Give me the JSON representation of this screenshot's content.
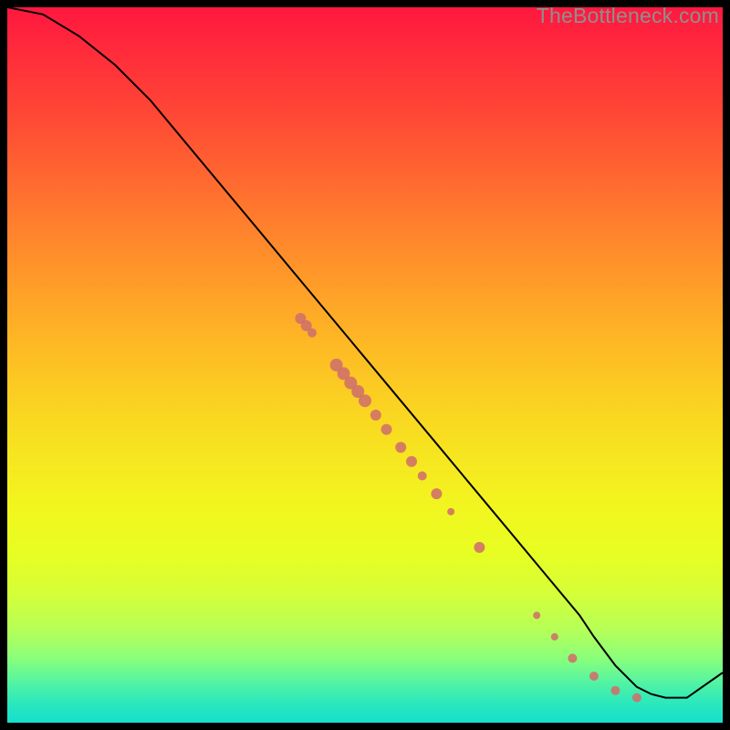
{
  "watermark": {
    "text": "TheBottleneck.com"
  },
  "chart_data": {
    "type": "line",
    "title": "",
    "xlabel": "",
    "ylabel": "",
    "xlim": [
      0,
      100
    ],
    "ylim": [
      0,
      100
    ],
    "grid": false,
    "legend": false,
    "series": [
      {
        "name": "curve",
        "x": [
          0,
          5,
          10,
          15,
          20,
          25,
          30,
          35,
          40,
          45,
          50,
          55,
          60,
          65,
          70,
          75,
          80,
          82,
          85,
          88,
          90,
          92,
          95,
          100
        ],
        "y": [
          100,
          99,
          96,
          92,
          87,
          81,
          75,
          69,
          63,
          57,
          51,
          45,
          39,
          33,
          27,
          21,
          15,
          12,
          8,
          5,
          4,
          3.5,
          3.5,
          7
        ],
        "color": "#000000",
        "linewidth": 2
      }
    ],
    "markers": [
      {
        "x": 41.0,
        "y": 56.5,
        "r": 6
      },
      {
        "x": 41.8,
        "y": 55.5,
        "r": 6
      },
      {
        "x": 42.6,
        "y": 54.5,
        "r": 5
      },
      {
        "x": 46.0,
        "y": 50.0,
        "r": 7
      },
      {
        "x": 47.0,
        "y": 48.8,
        "r": 7
      },
      {
        "x": 48.0,
        "y": 47.5,
        "r": 7
      },
      {
        "x": 49.0,
        "y": 46.3,
        "r": 7
      },
      {
        "x": 50.0,
        "y": 45.0,
        "r": 7
      },
      {
        "x": 51.5,
        "y": 43.0,
        "r": 6
      },
      {
        "x": 53.0,
        "y": 41.0,
        "r": 6
      },
      {
        "x": 55.0,
        "y": 38.5,
        "r": 6
      },
      {
        "x": 56.5,
        "y": 36.5,
        "r": 6
      },
      {
        "x": 58.0,
        "y": 34.5,
        "r": 5
      },
      {
        "x": 60.0,
        "y": 32.0,
        "r": 6
      },
      {
        "x": 62.0,
        "y": 29.5,
        "r": 4
      },
      {
        "x": 66.0,
        "y": 24.5,
        "r": 6
      },
      {
        "x": 74.0,
        "y": 15.0,
        "r": 4
      },
      {
        "x": 76.5,
        "y": 12.0,
        "r": 4
      },
      {
        "x": 79.0,
        "y": 9.0,
        "r": 5
      },
      {
        "x": 82.0,
        "y": 6.5,
        "r": 5
      },
      {
        "x": 85.0,
        "y": 4.5,
        "r": 5
      },
      {
        "x": 88.0,
        "y": 3.5,
        "r": 5
      }
    ],
    "marker_color": "#cf6f6a"
  }
}
